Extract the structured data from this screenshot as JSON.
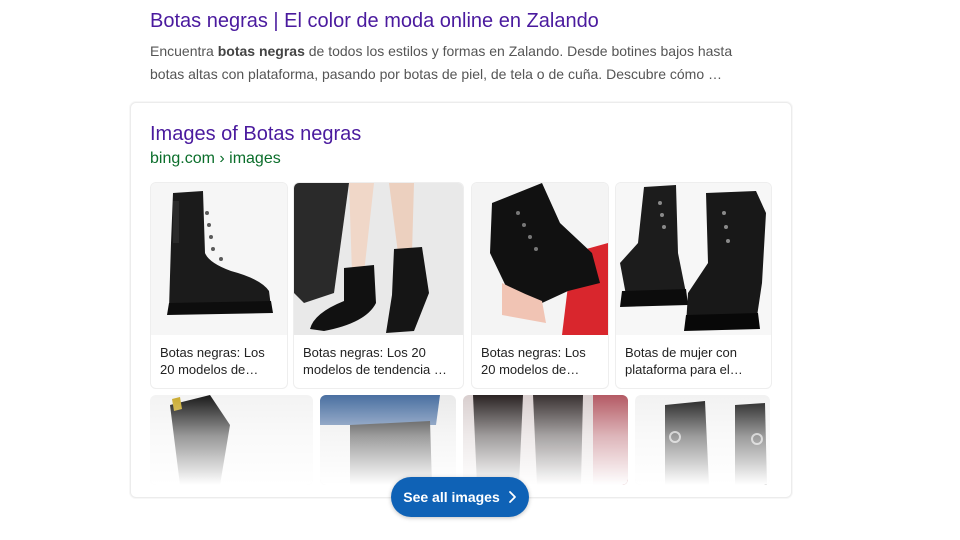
{
  "result": {
    "title": "Botas negras | El color de moda online en Zalando",
    "snippet_line1_pre": "Encuentra ",
    "snippet_line1_bold": "botas negras",
    "snippet_line1_post": " de todos los estilos y formas en Zalando. Desde botines bajos hasta",
    "snippet_line2": "botas altas con plataforma, pasando por botas de piel, de tela o de cuña. Descubre cómo …"
  },
  "images_card": {
    "title": "Images of Botas negras",
    "source": "bing.com › images",
    "thumbnails": [
      {
        "line1": "Botas negras: Los",
        "line2": "20 modelos de…",
        "icon": "combat-boot-image"
      },
      {
        "line1": "Botas negras: Los 20",
        "line2": "modelos de tendencia …",
        "icon": "heeled-ankle-boot-image"
      },
      {
        "line1": "Botas negras: Los",
        "line2": "20 modelos de…",
        "icon": "lace-up-boot-held-image"
      },
      {
        "line1": "Botas de mujer con",
        "line2": "plataforma para el…",
        "icon": "platform-boots-pair-image"
      }
    ],
    "more_thumbnails": [
      "boot-image",
      "knee-boot-image",
      "boot-store-image",
      "zip-boot-image"
    ],
    "see_all_label": "See all images",
    "see_all_icon": "chevron-right-icon"
  },
  "colors": {
    "title_link": "#4a1a9e",
    "url_green": "#0b6e2b",
    "button_blue": "#0f62b6"
  }
}
